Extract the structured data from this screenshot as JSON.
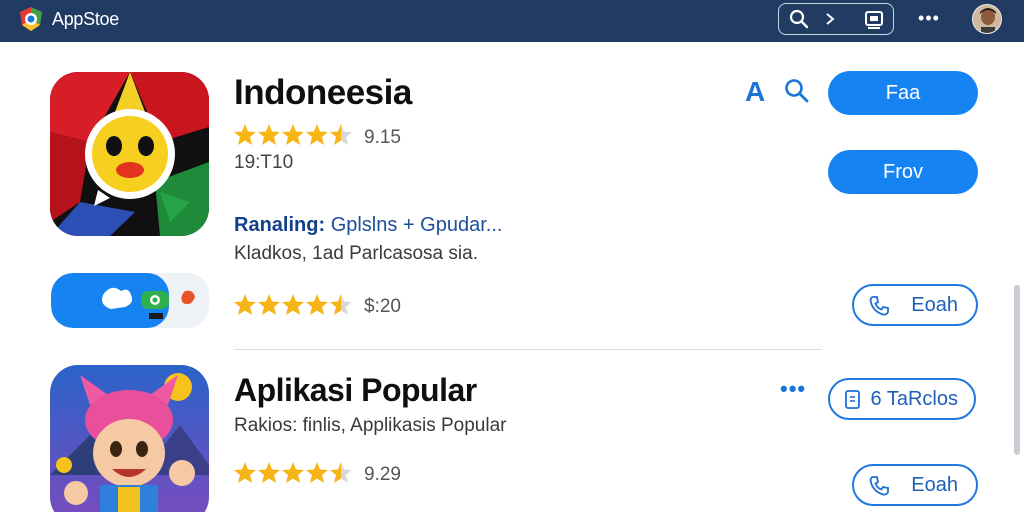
{
  "header": {
    "title": "AppStoe",
    "search_icon": "search-icon",
    "chevron_icon": "chevron-right-icon",
    "tablet_icon": "device-icon",
    "more_label": "•••"
  },
  "apps": [
    {
      "name": "Indoneesia",
      "rating": 4.5,
      "rating_text": "9.15",
      "meta": "19:T10",
      "ranking_label": "Ranaling:",
      "ranking_text": "Gplslns + Gpudar...",
      "description": "Kladkos, 1ad Parlcasosa sia.",
      "primary_button": "Faa",
      "secondary_button": "Frov",
      "top_letter": "A"
    },
    {
      "rating": 4.5,
      "rating_text": "$:20",
      "button": "Eoah"
    },
    {
      "name": "Aplikasi Popular",
      "description": "Rakios: finlis, Applikasis Popular",
      "rating": 4.5,
      "rating_text": "9.29",
      "tag_button": "6 TaRclos",
      "button": "Eoah",
      "more_label": "•••"
    }
  ],
  "colors": {
    "topbar": "#223b63",
    "accent": "#1683f2",
    "star": "#f6b415"
  }
}
